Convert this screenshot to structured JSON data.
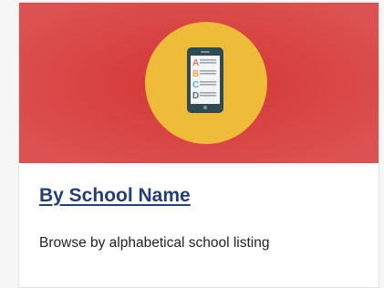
{
  "card": {
    "title": "By School Name",
    "description": "Browse by alphabetical school listing",
    "icon": "phone-alphabet-list-icon",
    "letters": [
      "A",
      "B",
      "C",
      "D"
    ],
    "colors": {
      "banner": "#dc5151",
      "circle": "#efbc3a",
      "phone": "#2f4a52",
      "title": "#253e7a",
      "letter_a": "#e8706c",
      "letter_b": "#f0a94a",
      "letter_c": "#54b6d6",
      "letter_d": "#5e6f7a"
    }
  }
}
